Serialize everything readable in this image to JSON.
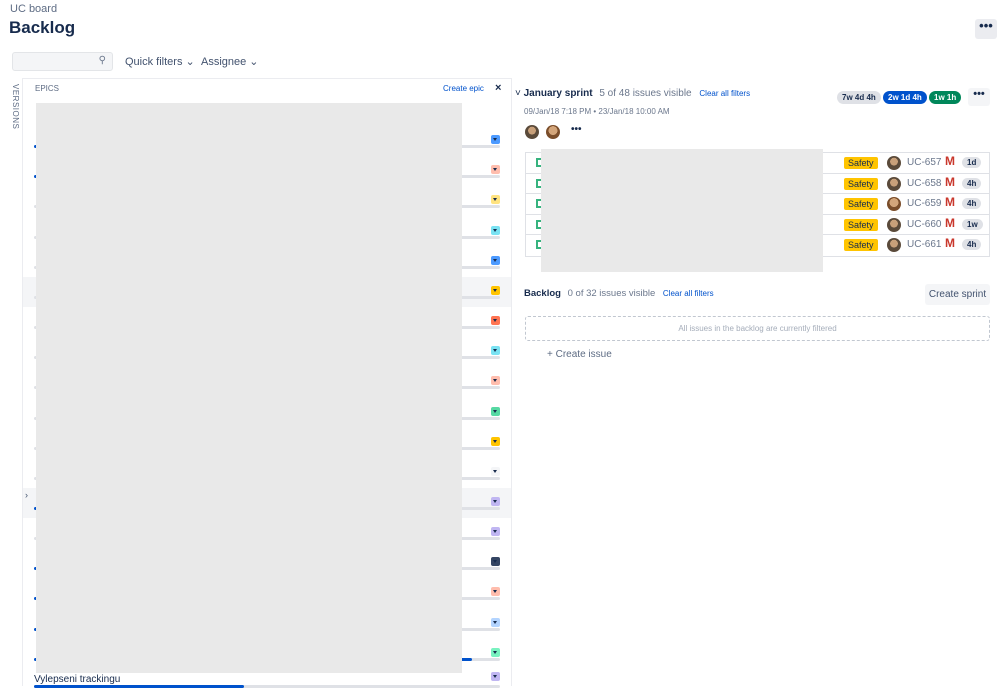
{
  "breadcrumb": "UC board",
  "page_title": "Backlog",
  "more_label": "•••",
  "toolbar": {
    "search_placeholder": "",
    "search_icon": "⚲",
    "quick_filters": "Quick filters ⌄",
    "assignee": "Assignee ⌄"
  },
  "versions_label": "VERSIONS",
  "epics": {
    "header": "EPICS",
    "create": "Create epic",
    "close": "×",
    "items": [
      {
        "color": "",
        "progress": 0
      },
      {
        "color": "#4c9aff",
        "progress": 1
      },
      {
        "color": "#ffbdad",
        "progress": 1
      },
      {
        "color": "#ffe380",
        "progress": 0
      },
      {
        "color": "#79e2f2",
        "progress": 0
      },
      {
        "color": "#4c9aff",
        "progress": 0
      },
      {
        "color": "#ffc400",
        "progress": 0
      },
      {
        "color": "#ff7452",
        "progress": 0
      },
      {
        "color": "#79e2f2",
        "progress": 0
      },
      {
        "color": "#ffbdad",
        "progress": 0
      },
      {
        "color": "#57d9a3",
        "progress": 0
      },
      {
        "color": "#ffc400",
        "progress": 0
      },
      {
        "color": "#f4f5f7",
        "progress": 0
      },
      {
        "color": "#c0b6f2",
        "progress": 1
      },
      {
        "color": "#c0b6f2",
        "progress": 0
      },
      {
        "color": "#344563",
        "progress": 1
      },
      {
        "color": "#ffbdad",
        "progress": 1
      },
      {
        "color": "#b3d4ff",
        "progress": 1
      },
      {
        "color": "#79f2c0",
        "progress": 94
      },
      {
        "color": "#c0b6f2",
        "progress": 45,
        "name": "Vylepseni trackingu"
      }
    ]
  },
  "sprint": {
    "name": "January sprint",
    "visible": "5 of 48 issues visible",
    "clear": "Clear all filters",
    "dates": "09/Jan/18 7:18 PM  •  23/Jan/18 10:00 AM",
    "estimates": [
      {
        "label": "7w 4d 4h",
        "bg": "#dfe1e6",
        "fg": "#172b4d"
      },
      {
        "label": "2w 1d 4h",
        "bg": "#0052cc",
        "fg": "#ffffff"
      },
      {
        "label": "1w 1h",
        "bg": "#00875a",
        "fg": "#ffffff"
      }
    ],
    "more": "•••",
    "issues": [
      {
        "epic": "Safety",
        "key": "UC-657",
        "priority": "M",
        "estimate": "1d"
      },
      {
        "epic": "Safety",
        "key": "UC-658",
        "priority": "M",
        "estimate": "4h"
      },
      {
        "epic": "Safety",
        "key": "UC-659",
        "priority": "M",
        "estimate": "4h"
      },
      {
        "epic": "Safety",
        "key": "UC-660",
        "priority": "M",
        "estimate": "1w"
      },
      {
        "epic": "Safety",
        "key": "UC-661",
        "priority": "M",
        "estimate": "4h"
      }
    ]
  },
  "backlog": {
    "title": "Backlog",
    "visible": "0 of 32 issues visible",
    "clear": "Clear all filters",
    "create_sprint": "Create sprint",
    "empty": "All issues in the backlog are currently filtered",
    "create_issue": "+  Create issue"
  }
}
